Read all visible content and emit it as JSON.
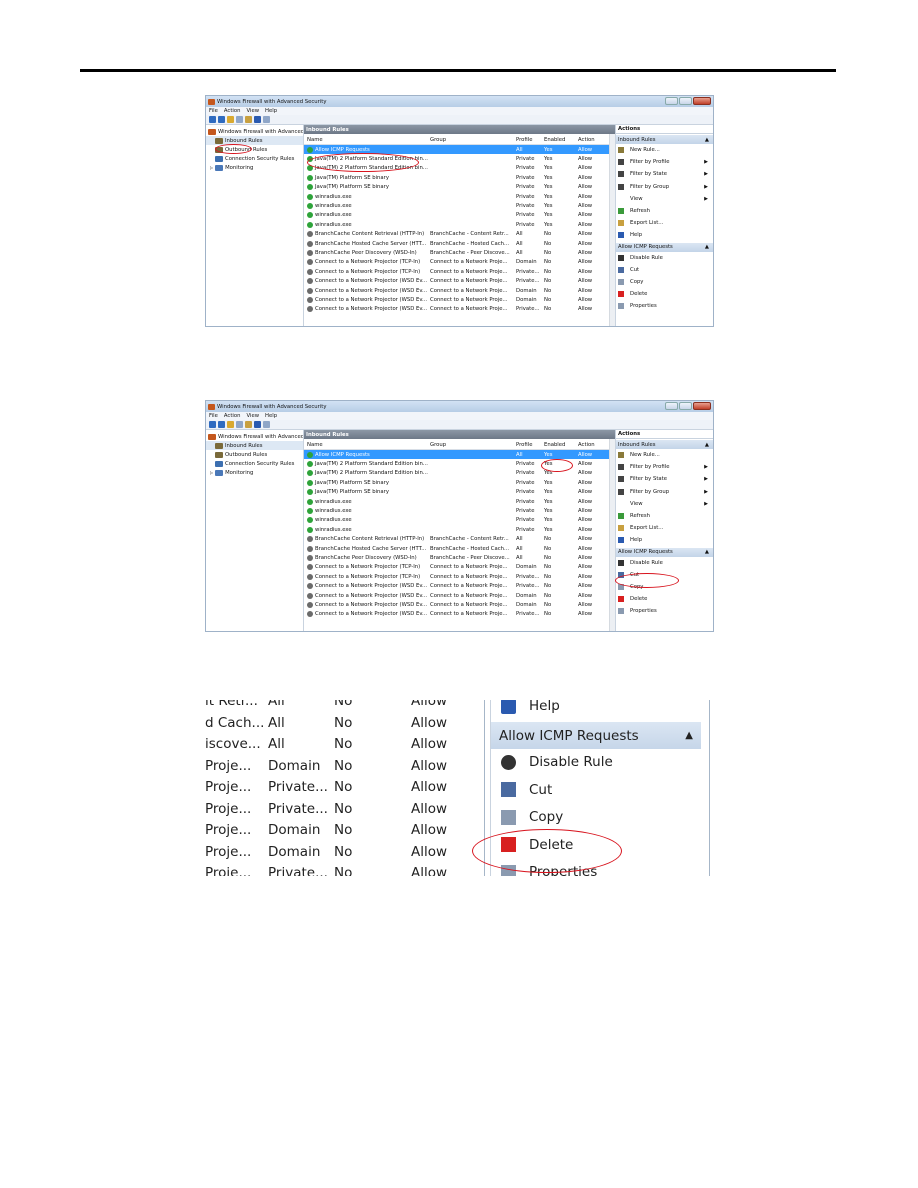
{
  "window": {
    "title": "Windows Firewall with Advanced Security"
  },
  "menu": [
    "File",
    "Action",
    "View",
    "Help"
  ],
  "tree": [
    {
      "label": "Windows Firewall with Advanced",
      "color": "#c4571d"
    },
    {
      "label": "Inbound Rules",
      "color": "#7a6a3a"
    },
    {
      "label": "Outbound Rules",
      "color": "#7a6a3a"
    },
    {
      "label": "Connection Security Rules",
      "color": "#3c6fb0"
    },
    {
      "label": "Monitoring",
      "color": "#4a78b8"
    }
  ],
  "center": {
    "header": "Inbound Rules",
    "columns": [
      "Name",
      "Group",
      "Profile",
      "Enabled",
      "Action"
    ],
    "rows": [
      {
        "name": "Allow ICMP Requests",
        "group": "",
        "profile": "All",
        "enabled": "Yes",
        "action": "Allow",
        "icon": "g"
      },
      {
        "name": "Java(TM) 2 Platform Standard Edition bin...",
        "group": "",
        "profile": "Private",
        "enabled": "Yes",
        "action": "Allow",
        "icon": "g"
      },
      {
        "name": "Java(TM) 2 Platform Standard Edition bin...",
        "group": "",
        "profile": "Private",
        "enabled": "Yes",
        "action": "Allow",
        "icon": "g"
      },
      {
        "name": "Java(TM) Platform SE binary",
        "group": "",
        "profile": "Private",
        "enabled": "Yes",
        "action": "Allow",
        "icon": "g"
      },
      {
        "name": "Java(TM) Platform SE binary",
        "group": "",
        "profile": "Private",
        "enabled": "Yes",
        "action": "Allow",
        "icon": "g"
      },
      {
        "name": "winradius.exe",
        "group": "",
        "profile": "Private",
        "enabled": "Yes",
        "action": "Allow",
        "icon": "g"
      },
      {
        "name": "winradius.exe",
        "group": "",
        "profile": "Private",
        "enabled": "Yes",
        "action": "Allow",
        "icon": "g"
      },
      {
        "name": "winradius.exe",
        "group": "",
        "profile": "Private",
        "enabled": "Yes",
        "action": "Allow",
        "icon": "g"
      },
      {
        "name": "winradius.exe",
        "group": "",
        "profile": "Private",
        "enabled": "Yes",
        "action": "Allow",
        "icon": "g"
      },
      {
        "name": "BranchCache Content Retrieval (HTTP-In)",
        "group": "BranchCache - Content Retr...",
        "profile": "All",
        "enabled": "No",
        "action": "Allow",
        "icon": "k"
      },
      {
        "name": "BranchCache Hosted Cache Server (HTT...",
        "group": "BranchCache - Hosted Cach...",
        "profile": "All",
        "enabled": "No",
        "action": "Allow",
        "icon": "k"
      },
      {
        "name": "BranchCache Peer Discovery (WSD-In)",
        "group": "BranchCache - Peer Discove...",
        "profile": "All",
        "enabled": "No",
        "action": "Allow",
        "icon": "k"
      },
      {
        "name": "Connect to a Network Projector (TCP-In)",
        "group": "Connect to a Network Proje...",
        "profile": "Domain",
        "enabled": "No",
        "action": "Allow",
        "icon": "k"
      },
      {
        "name": "Connect to a Network Projector (TCP-In)",
        "group": "Connect to a Network Proje...",
        "profile": "Private...",
        "enabled": "No",
        "action": "Allow",
        "icon": "k"
      },
      {
        "name": "Connect to a Network Projector (WSD Ev...",
        "group": "Connect to a Network Proje...",
        "profile": "Private...",
        "enabled": "No",
        "action": "Allow",
        "icon": "k"
      },
      {
        "name": "Connect to a Network Projector (WSD Ev...",
        "group": "Connect to a Network Proje...",
        "profile": "Domain",
        "enabled": "No",
        "action": "Allow",
        "icon": "k"
      },
      {
        "name": "Connect to a Network Projector (WSD Ev...",
        "group": "Connect to a Network Proje...",
        "profile": "Domain",
        "enabled": "No",
        "action": "Allow",
        "icon": "k"
      },
      {
        "name": "Connect to a Network Projector (WSD Ev...",
        "group": "Connect to a Network Proje...",
        "profile": "Private...",
        "enabled": "No",
        "action": "Allow",
        "icon": "k"
      }
    ]
  },
  "actions": {
    "header": "Actions",
    "section1": "Inbound Rules",
    "items1": [
      {
        "label": "New Rule...",
        "icon": "new-rule-icon",
        "color": "#8a7a3a",
        "arrow": false
      },
      {
        "label": "Filter by Profile",
        "icon": "filter-icon",
        "color": "#444",
        "arrow": true
      },
      {
        "label": "Filter by State",
        "icon": "filter-icon",
        "color": "#444",
        "arrow": true
      },
      {
        "label": "Filter by Group",
        "icon": "filter-icon",
        "color": "#444",
        "arrow": true
      },
      {
        "label": "View",
        "icon": "view-icon",
        "color": "#ffffff",
        "arrow": true
      },
      {
        "label": "Refresh",
        "icon": "refresh-icon",
        "color": "#3a9a3a",
        "arrow": false
      },
      {
        "label": "Export List...",
        "icon": "export-icon",
        "color": "#c8a040",
        "arrow": false
      },
      {
        "label": "Help",
        "icon": "help-icon",
        "color": "#2a5ab0",
        "arrow": false
      }
    ],
    "section2": "Allow ICMP Requests",
    "items2": [
      {
        "label": "Disable Rule",
        "icon": "disable-rule-icon",
        "color": "#333"
      },
      {
        "label": "Cut",
        "icon": "cut-icon",
        "color": "#4a6aa0"
      },
      {
        "label": "Copy",
        "icon": "copy-icon",
        "color": "#8a9ab0"
      },
      {
        "label": "Delete",
        "icon": "delete-icon",
        "color": "#d82020"
      },
      {
        "label": "Properties",
        "icon": "properties-icon",
        "color": "#8a9ab0"
      }
    ]
  },
  "zoom": {
    "rows": [
      {
        "group": "it Retr...",
        "profile": "All",
        "enabled": "No",
        "action": "Allow"
      },
      {
        "group": "d Cach...",
        "profile": "All",
        "enabled": "No",
        "action": "Allow"
      },
      {
        "group": "iscove...",
        "profile": "All",
        "enabled": "No",
        "action": "Allow"
      },
      {
        "group": "Proje...",
        "profile": "Domain",
        "enabled": "No",
        "action": "Allow"
      },
      {
        "group": "Proje...",
        "profile": "Private...",
        "enabled": "No",
        "action": "Allow"
      },
      {
        "group": "Proje...",
        "profile": "Private...",
        "enabled": "No",
        "action": "Allow"
      },
      {
        "group": "Proje...",
        "profile": "Domain",
        "enabled": "No",
        "action": "Allow"
      },
      {
        "group": "Proje...",
        "profile": "Domain",
        "enabled": "No",
        "action": "Allow"
      },
      {
        "group": "Proje...",
        "profile": "Private...",
        "enabled": "No",
        "action": "Allow"
      }
    ],
    "help": "Help",
    "section": "Allow ICMP Requests",
    "items": [
      {
        "label": "Disable Rule",
        "icon": "disable-rule-icon",
        "color": "#333"
      },
      {
        "label": "Cut",
        "icon": "cut-icon",
        "color": "#4a6aa0"
      },
      {
        "label": "Copy",
        "icon": "copy-icon",
        "color": "#8a9ab0"
      },
      {
        "label": "Delete",
        "icon": "delete-icon",
        "color": "#d82020"
      },
      {
        "label": "Properties",
        "icon": "properties-icon",
        "color": "#8a9ab0"
      }
    ]
  },
  "colors": {
    "highlight_oval": "#d8141e",
    "selection": "#3399ff"
  }
}
